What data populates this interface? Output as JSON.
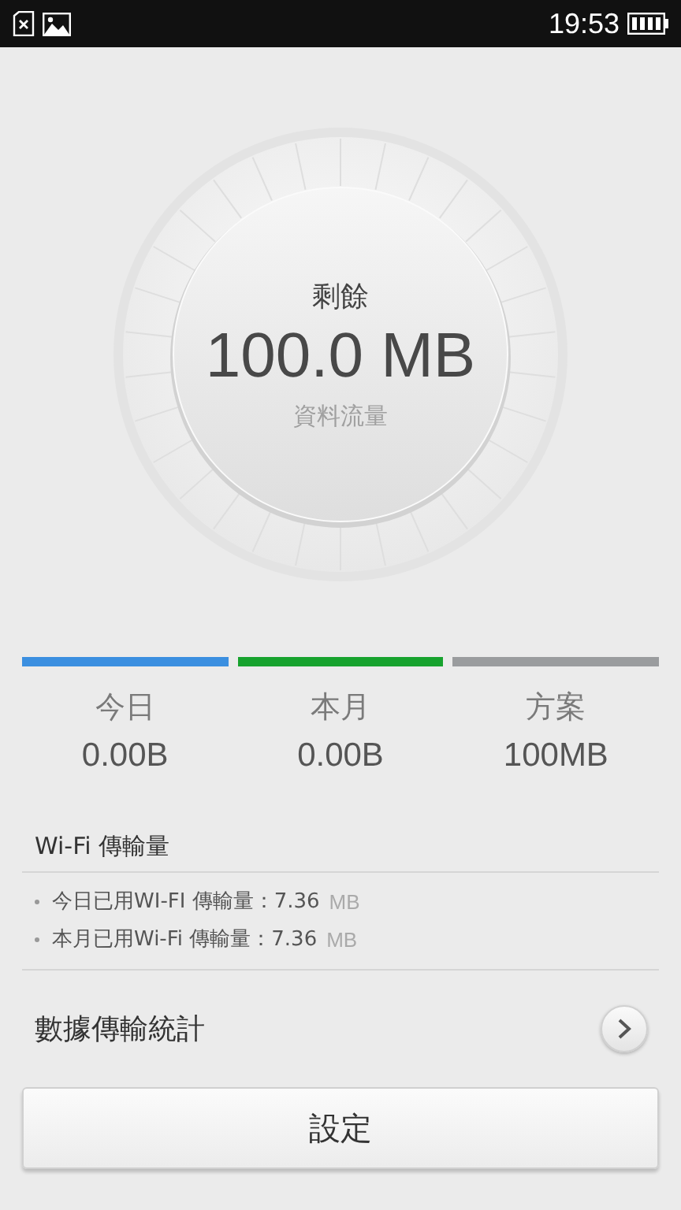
{
  "status_bar": {
    "time": "19:53"
  },
  "dial": {
    "label": "剩餘",
    "value": "100.0 MB",
    "caption": "資料流量"
  },
  "stats": [
    {
      "label": "今日",
      "value": "0.00B",
      "color": "#3b8fe0"
    },
    {
      "label": "本月",
      "value": "0.00B",
      "color": "#17a22e"
    },
    {
      "label": "方案",
      "value": "100MB",
      "color": "#9a9c9e"
    }
  ],
  "wifi": {
    "title": "Wi-Fi 傳輸量",
    "rows": [
      {
        "text": "今日已用WI-FI 傳輸量：7.36",
        "unit": "MB"
      },
      {
        "text": "本月已用Wi-Fi 傳輸量：7.36",
        "unit": "MB"
      }
    ]
  },
  "stats_link": {
    "label": "數據傳輸統計"
  },
  "button": "設定"
}
